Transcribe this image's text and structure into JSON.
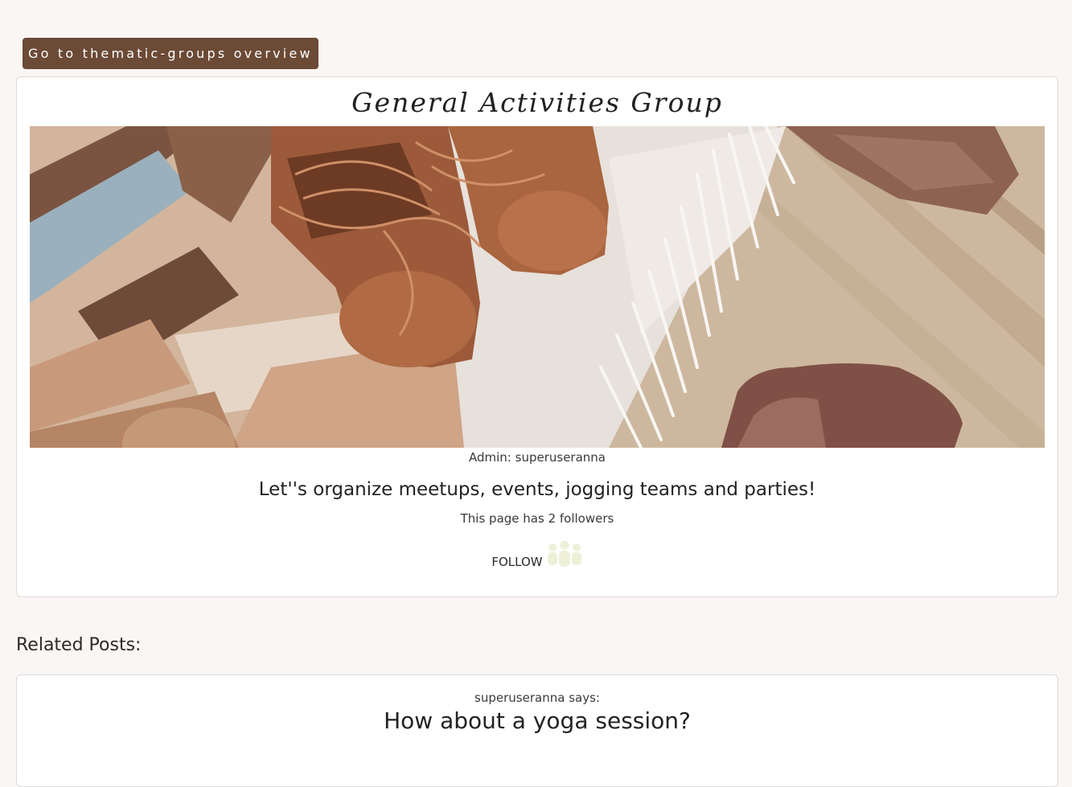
{
  "nav": {
    "back_label": "Go to thematic-groups overview"
  },
  "group": {
    "title": "General Activities Group",
    "admin_prefix": "Admin:",
    "admin_name": "superuseranna",
    "tagline": "Let''s organize meetups, events, jogging teams and parties!",
    "followers_text": "This page has 2 followers",
    "follow_label": "FOLLOW",
    "follow_icon": "people-group-icon"
  },
  "related": {
    "heading": "Related Posts:",
    "posts": [
      {
        "author": "superuseranna",
        "says": "says:",
        "title": "How about a yoga session?"
      }
    ]
  },
  "colors": {
    "page_background": "#faf6f3",
    "button_brown": "#6b4a36",
    "follow_icon": "#eef0d8"
  }
}
